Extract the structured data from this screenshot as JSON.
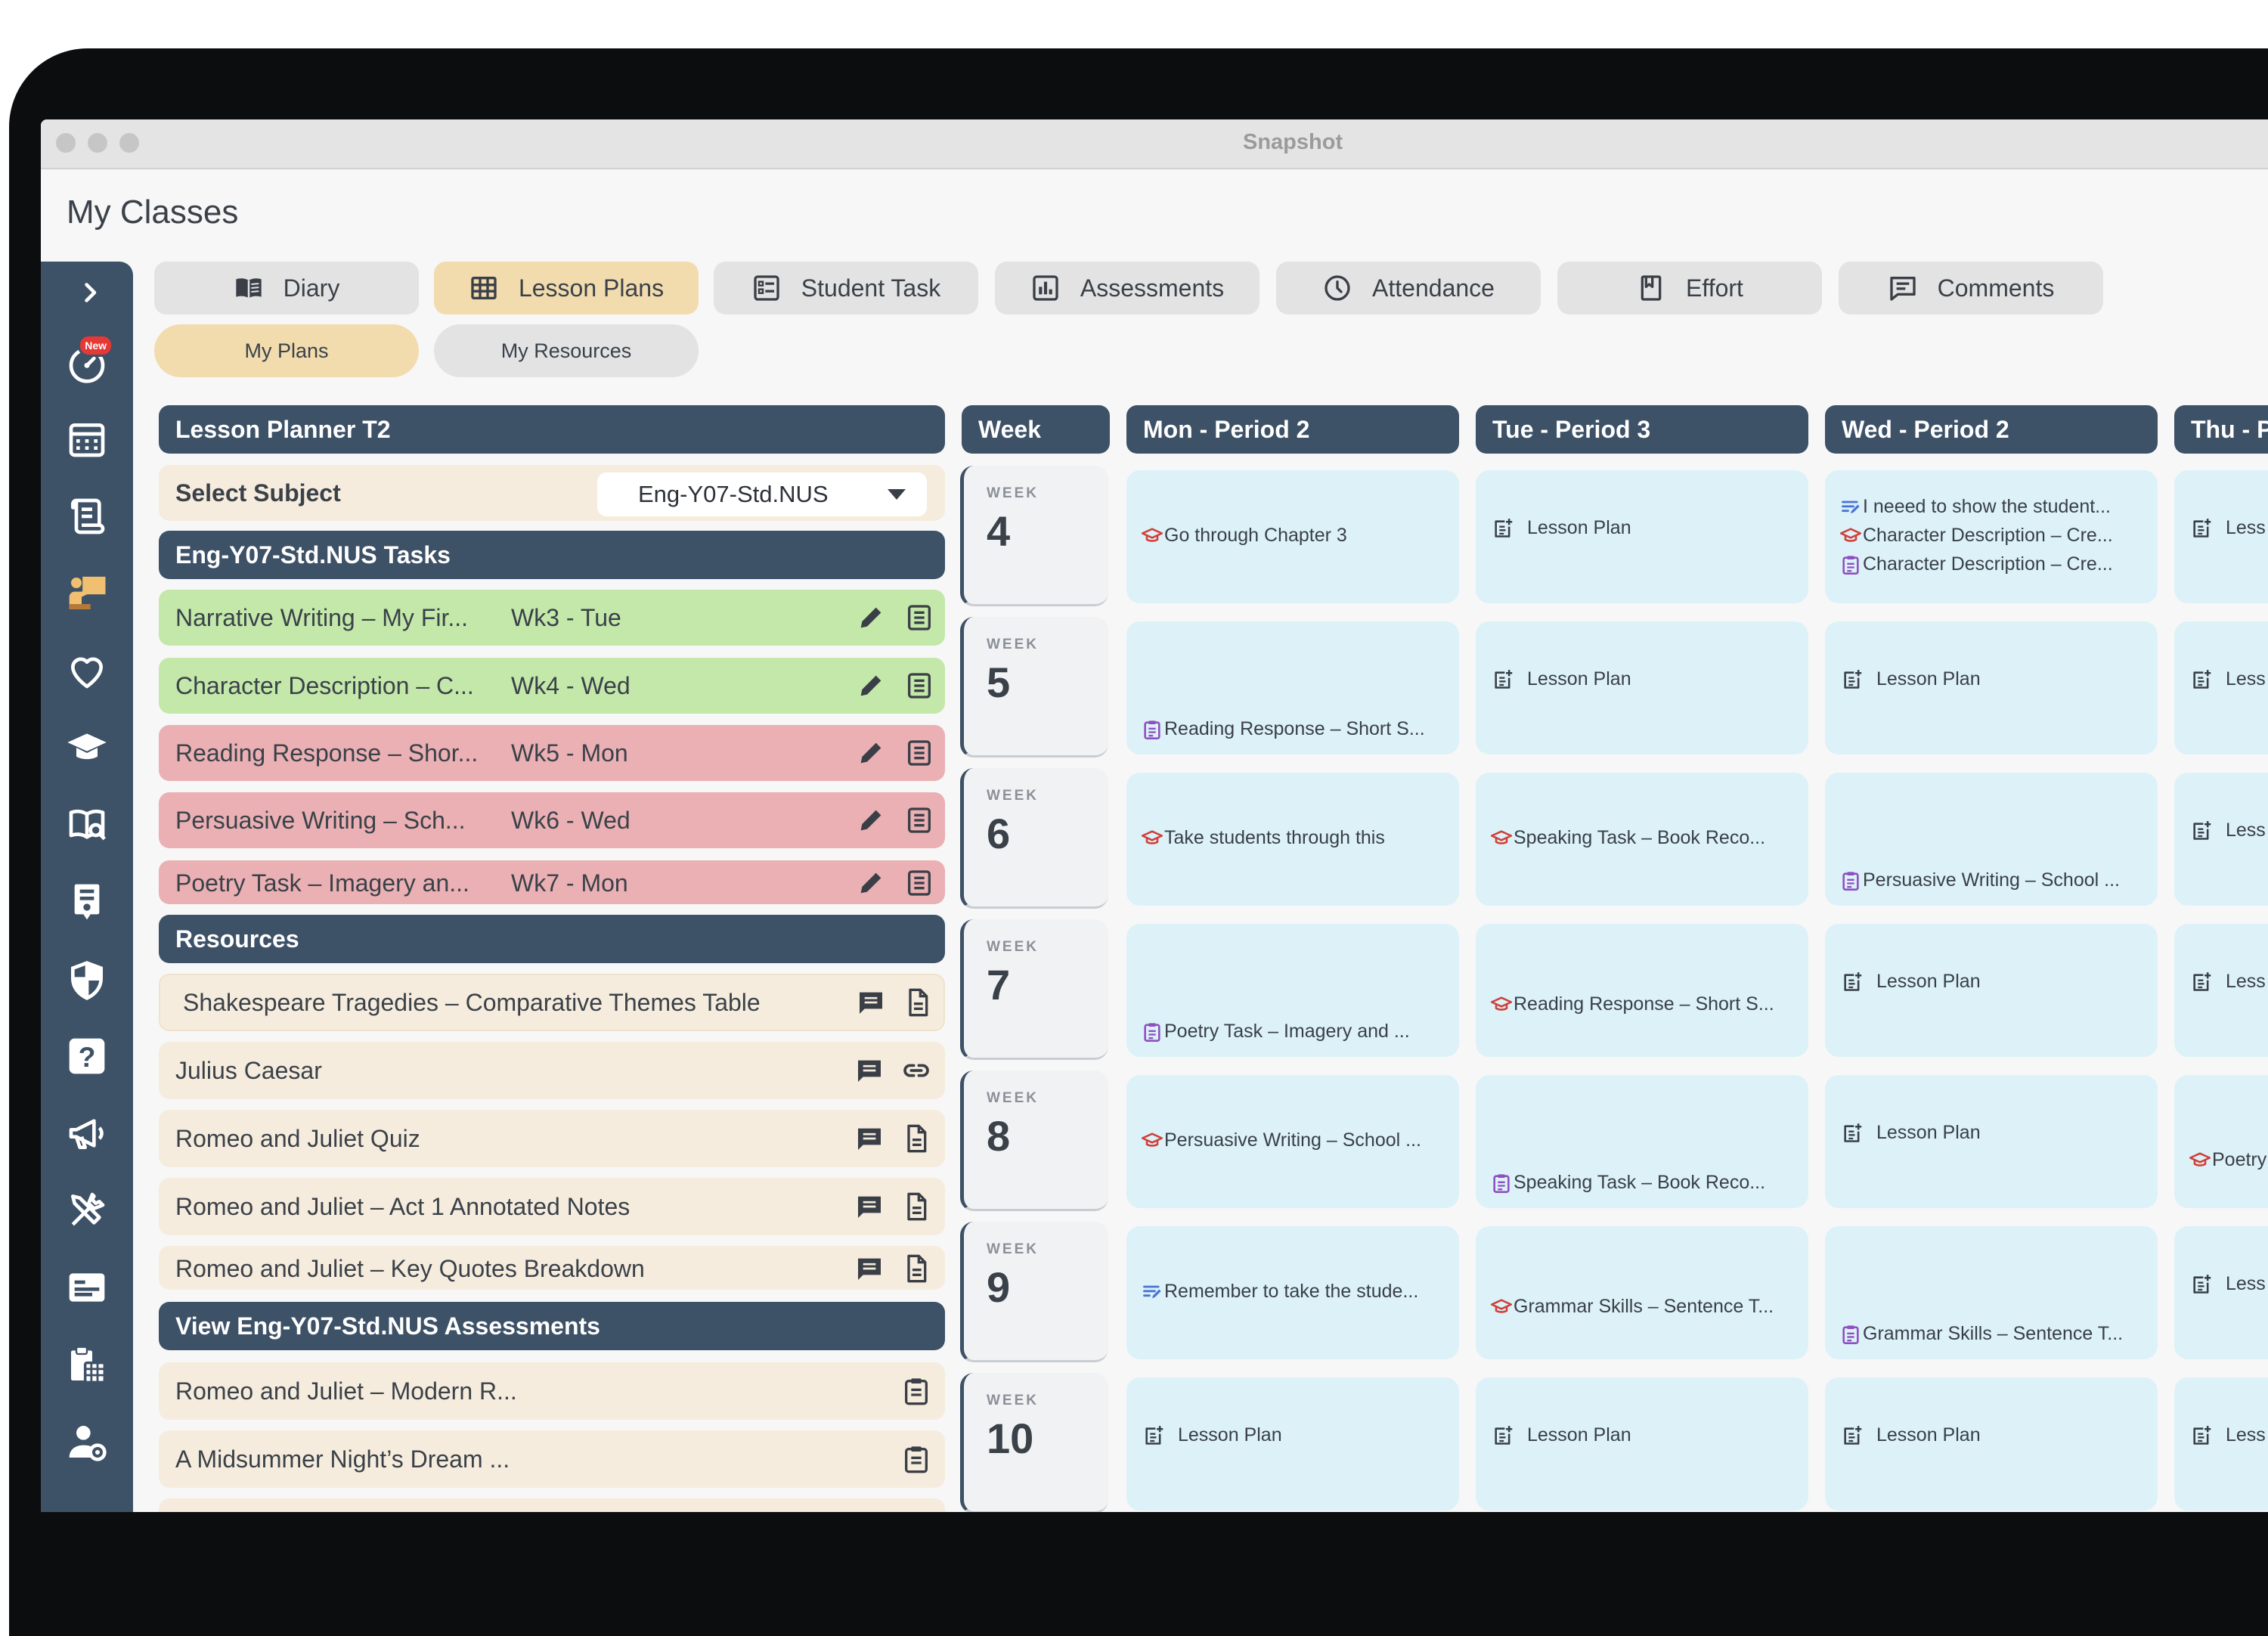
{
  "window": {
    "title": "Snapshot"
  },
  "page_title": "My Classes",
  "sidebar": {
    "icons": [
      "chevron-right-icon",
      "speedometer-icon",
      "calendar-grid-icon",
      "scroll-icon",
      "teacher-icon",
      "heart-icon",
      "graduation-cap-icon",
      "book-search-icon",
      "certificate-icon",
      "shield-icon",
      "question-icon",
      "megaphone-icon",
      "tools-icon",
      "id-card-icon",
      "timetable-icon",
      "user-settings-icon"
    ],
    "new_badge": "New"
  },
  "tabs": [
    {
      "label": "Diary",
      "icon": "book-icon"
    },
    {
      "label": "Lesson Plans",
      "icon": "grid-icon",
      "active": true
    },
    {
      "label": "Student Task",
      "icon": "task-icon"
    },
    {
      "label": "Assessments",
      "icon": "chart-icon"
    },
    {
      "label": "Attendance",
      "icon": "clock-icon"
    },
    {
      "label": "Effort",
      "icon": "bookmark-icon"
    },
    {
      "label": "Comments",
      "icon": "comment-icon"
    }
  ],
  "subtabs": [
    {
      "label": "My Plans",
      "active": true
    },
    {
      "label": "My Resources"
    }
  ],
  "planner": {
    "title": "Lesson Planner T2",
    "select_label": "Select Subject",
    "select_value": "Eng-Y07-Std.NUS",
    "tasks_header": "Eng-Y07-Std.NUS Tasks",
    "tasks": [
      {
        "title": "Narrative Writing – My Fir...",
        "week": "Wk3 - Tue",
        "color": "green"
      },
      {
        "title": "Character Description – C...",
        "week": "Wk4 - Wed",
        "color": "green"
      },
      {
        "title": "Reading Response – Shor...",
        "week": "Wk5 - Mon",
        "color": "pink"
      },
      {
        "title": "Persuasive Writing – Sch...",
        "week": "Wk6 - Wed",
        "color": "pink"
      },
      {
        "title": "Poetry Task – Imagery an...",
        "week": "Wk7 - Mon",
        "color": "pink"
      }
    ],
    "resources_header": "Resources",
    "resources": [
      {
        "title": "Shakespeare Tragedies – Comparative Themes Table",
        "icon2": "document-icon"
      },
      {
        "title": "Julius Caesar",
        "icon2": "link-icon"
      },
      {
        "title": "Romeo and Juliet Quiz",
        "icon2": "document-icon"
      },
      {
        "title": "Romeo and Juliet – Act 1 Annotated Notes",
        "icon2": "document-icon"
      },
      {
        "title": "Romeo and Juliet – Key Quotes Breakdown",
        "icon2": "document-icon"
      }
    ],
    "assessments_header": "View Eng-Y07-Std.NUS Assessments",
    "assessments": [
      {
        "title": "Romeo and Juliet – Modern R..."
      },
      {
        "title": "A Midsummer Night’s Dream ..."
      }
    ]
  },
  "calendar": {
    "week_header": "Week",
    "week_label": "WEEK",
    "columns": [
      "Mon - Period 2",
      "Tue - Period 3",
      "Wed - Period 2",
      "Thu - P"
    ],
    "weeks": [
      {
        "num": "4",
        "cells": [
          [
            {
              "icon": "cap-icon",
              "text": "Go through Chapter 3"
            }
          ],
          [
            {
              "icon": "add-note-icon",
              "text": "Lesson Plan"
            }
          ],
          [
            {
              "icon": "notes-icon",
              "text": "I neeed to show the student..."
            },
            {
              "icon": "cap-icon",
              "text": "Character Description – Cre..."
            },
            {
              "icon": "clipboard-icon",
              "text": "Character Description – Cre..."
            }
          ],
          [
            {
              "icon": "add-note-icon",
              "text": "Less"
            }
          ]
        ]
      },
      {
        "num": "5",
        "cells": [
          [
            {
              "icon": "clipboard-icon",
              "text": "Reading Response – Short S..."
            }
          ],
          [
            {
              "icon": "add-note-icon",
              "text": "Lesson Plan"
            }
          ],
          [
            {
              "icon": "add-note-icon",
              "text": "Lesson Plan"
            }
          ],
          [
            {
              "icon": "add-note-icon",
              "text": "Less"
            }
          ]
        ]
      },
      {
        "num": "6",
        "cells": [
          [
            {
              "icon": "cap-icon",
              "text": "Take students through this"
            }
          ],
          [
            {
              "icon": "cap-icon",
              "text": "Speaking Task – Book Reco..."
            }
          ],
          [
            {
              "icon": "clipboard-icon",
              "text": "Persuasive Writing – School ..."
            }
          ],
          [
            {
              "icon": "add-note-icon",
              "text": "Less"
            }
          ]
        ]
      },
      {
        "num": "7",
        "cells": [
          [
            {
              "icon": "clipboard-icon",
              "text": "Poetry Task – Imagery and ..."
            }
          ],
          [
            {
              "icon": "cap-icon",
              "text": "Reading Response – Short S..."
            }
          ],
          [
            {
              "icon": "add-note-icon",
              "text": "Lesson Plan"
            }
          ],
          [
            {
              "icon": "add-note-icon",
              "text": "Less"
            }
          ]
        ]
      },
      {
        "num": "8",
        "cells": [
          [
            {
              "icon": "cap-icon",
              "text": "Persuasive Writing – School ..."
            }
          ],
          [
            {
              "icon": "clipboard-icon",
              "text": "Speaking Task – Book Reco..."
            }
          ],
          [
            {
              "icon": "add-note-icon",
              "text": "Lesson Plan"
            }
          ],
          [
            {
              "icon": "cap-icon",
              "text": "Poetry"
            }
          ]
        ]
      },
      {
        "num": "9",
        "cells": [
          [
            {
              "icon": "notes-icon",
              "text": "Remember to take the stude..."
            }
          ],
          [
            {
              "icon": "cap-icon",
              "text": "Grammar Skills – Sentence T..."
            }
          ],
          [
            {
              "icon": "clipboard-icon",
              "text": "Grammar Skills – Sentence T..."
            }
          ],
          [
            {
              "icon": "add-note-icon",
              "text": "Less"
            }
          ]
        ]
      },
      {
        "num": "10",
        "cells": [
          [
            {
              "icon": "add-note-icon",
              "text": "Lesson Plan"
            }
          ],
          [
            {
              "icon": "add-note-icon",
              "text": "Lesson Plan"
            }
          ],
          [
            {
              "icon": "add-note-icon",
              "text": "Lesson Plan"
            }
          ],
          [
            {
              "icon": "add-note-icon",
              "text": "Less"
            }
          ]
        ]
      }
    ]
  },
  "colors": {
    "navy": "#3d5167",
    "accent": "#f2dcae",
    "green": "#c3e8a9",
    "pink": "#eab0b3",
    "cream": "#f6ecdd",
    "cell": "#dcf2f8",
    "cap": "#d0403a",
    "clipboard": "#8e4fc2",
    "notes": "#4a74d6"
  }
}
